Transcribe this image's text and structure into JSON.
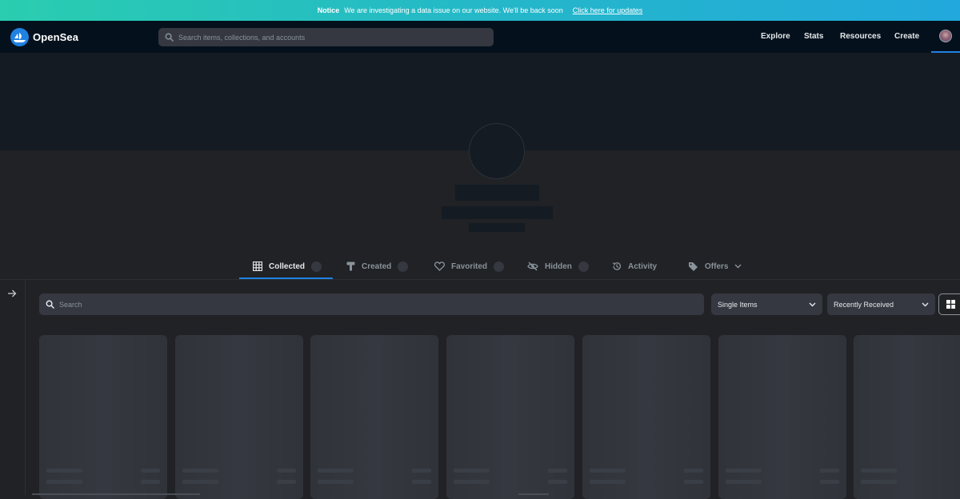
{
  "notice": {
    "label": "Notice",
    "message": "We are investigating a data issue on our website. We'll be back soon",
    "link": "Click here for updates"
  },
  "nav": {
    "brand": "OpenSea",
    "search_placeholder": "Search items, collections, and accounts",
    "links": [
      "Explore",
      "Stats",
      "Resources",
      "Create"
    ]
  },
  "tabs": [
    {
      "label": "Collected",
      "icon": "grid-icon",
      "active": true
    },
    {
      "label": "Created",
      "icon": "paintbrush-icon"
    },
    {
      "label": "Favorited",
      "icon": "heart-icon"
    },
    {
      "label": "Hidden",
      "icon": "eye-off-icon"
    },
    {
      "label": "Activity",
      "icon": "history-icon"
    },
    {
      "label": "Offers",
      "icon": "tag-icon"
    }
  ],
  "filters": {
    "search_placeholder": "Search",
    "item_type": "Single Items",
    "sort": "Recently Received"
  },
  "colors": {
    "accent": "#2081e2",
    "nav_bg": "#04111d",
    "page_bg": "#202225",
    "surface": "#353840"
  }
}
